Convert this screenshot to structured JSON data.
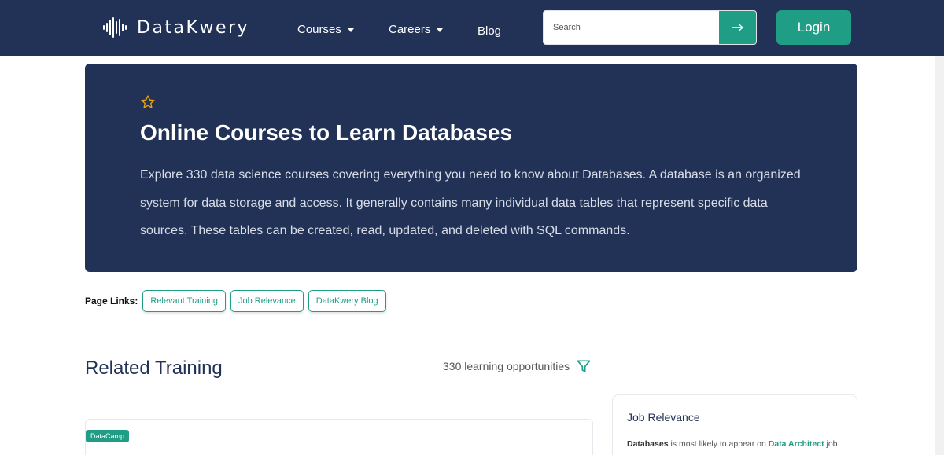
{
  "brand": {
    "name": "DataKwery"
  },
  "nav": {
    "courses": "Courses",
    "careers": "Careers",
    "blog": "Blog"
  },
  "search": {
    "placeholder": "Search"
  },
  "login": "Login",
  "hero": {
    "title": "Online Courses to Learn Databases",
    "description": "Explore 330 data science courses covering everything you need to know about Databases. A database is an organized system for data storage and access. It generally contains many individual data tables that represent specific data sources. These tables can be created, read, updated, and deleted with SQL commands."
  },
  "page_links": {
    "label": "Page Links:",
    "items": [
      "Relevant Training",
      "Job Relevance",
      "DataKwery Blog"
    ]
  },
  "related": {
    "title": "Related Training",
    "count_text": "330 learning opportunities"
  },
  "course_card": {
    "provider": "DataCamp"
  },
  "job_relevance": {
    "title": "Job Relevance",
    "subject": "Databases",
    "middle": " is most likely to appear on ",
    "role": "Data Architect",
    "tail": " job"
  },
  "colors": {
    "navy": "#223256",
    "teal": "#1f9d85",
    "star": "#f0a500"
  }
}
